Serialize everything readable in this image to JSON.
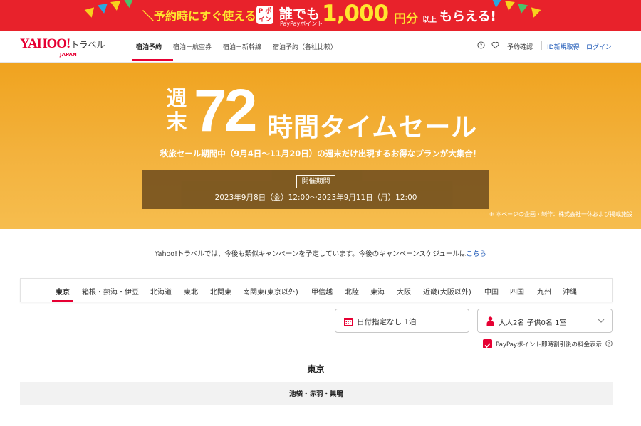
{
  "promo": {
    "lead": "＼予約時にすぐ使える／",
    "paypay_logo": "P ポイント",
    "daredemo": "誰でも",
    "paypay_point": "PayPayポイント",
    "amount": "1,000",
    "yen": "円分",
    "more": "以上",
    "get": "もらえる!",
    "colors": {
      "bg": "#e8222b",
      "accent": "#ffe52e"
    }
  },
  "header": {
    "logo_yahoo": "YAHOO!",
    "logo_japan": "JAPAN",
    "logo_travel": "トラベル",
    "nav": [
      "宿泊予約",
      "宿泊＋航空券",
      "宿泊＋新幹線",
      "宿泊予約（各社比較）"
    ],
    "active_nav": "宿泊予約",
    "icons": [
      "help-icon",
      "heart-icon"
    ],
    "reservation_check": "予約確認",
    "new_id": "ID新規取得",
    "login": "ログイン"
  },
  "hero": {
    "shu": "週",
    "matsu": "末",
    "big_number": "72",
    "title_rest": "時間タイムセール",
    "subtitle": "秋旅セール期間中（9月4日〜11月20日）の週末だけ出現するお得なプランが大集合！",
    "period_label": "開催期間",
    "period_dates": "2023年9月8日（金）12:00〜2023年9月11日（月）12:00",
    "note": "※ 本ページの企画・制作：株式会社一休および掲載施設",
    "colors": {
      "bg": "#f1a625",
      "period_box": "#76531f"
    }
  },
  "info": {
    "text": "Yahoo!トラベルでは、今後も類似キャンペーンを予定しています。今後のキャンペーンスケジュールは",
    "link": "こちら"
  },
  "region_tabs": {
    "items": [
      "東京",
      "箱根・熱海・伊豆",
      "北海道",
      "東北",
      "北関東",
      "南関東(東京以外)",
      "甲信越",
      "北陸",
      "東海",
      "大阪",
      "近畿(大阪以外)",
      "中国",
      "四国",
      "九州",
      "沖縄"
    ],
    "active": "東京"
  },
  "search": {
    "date": "日付指定なし 1泊",
    "guests": "大人2名 子供0名 1室",
    "paypay_checkbox_label": "PayPayポイント即時割引後の料金表示",
    "paypay_checked": true
  },
  "area": {
    "title": "東京",
    "subarea": "池袋・赤羽・巣鴨"
  }
}
